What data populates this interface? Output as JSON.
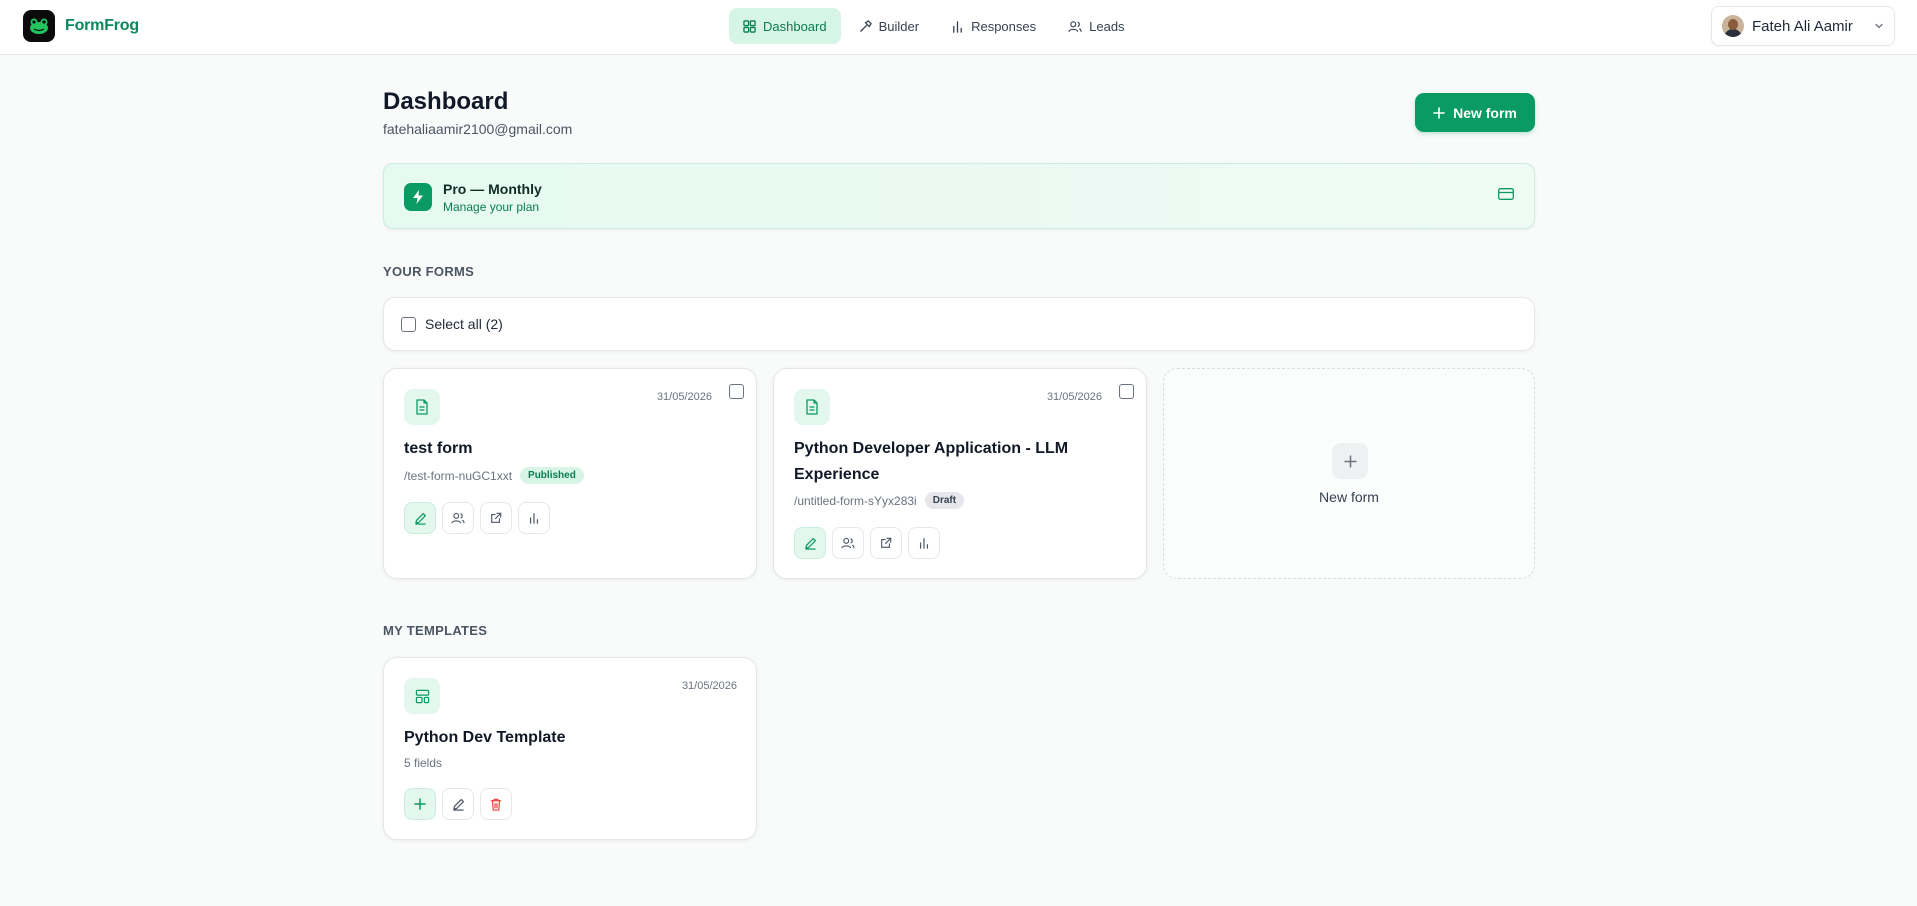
{
  "brand": {
    "name": "FormFrog"
  },
  "nav": {
    "items": [
      {
        "label": "Dashboard",
        "icon": "grid-icon",
        "active": true
      },
      {
        "label": "Builder",
        "icon": "hammer-icon",
        "active": false
      },
      {
        "label": "Responses",
        "icon": "bar-chart-icon",
        "active": false
      },
      {
        "label": "Leads",
        "icon": "users-icon",
        "active": false
      }
    ]
  },
  "user": {
    "name": "Fateh Ali Aamir"
  },
  "header": {
    "title": "Dashboard",
    "email": "fatehaliaamir2100@gmail.com",
    "new_form_label": "New form"
  },
  "plan": {
    "title": "Pro — Monthly",
    "subtitle": "Manage your plan"
  },
  "forms_section": {
    "label": "YOUR FORMS",
    "select_all_label": "Select all (2)",
    "forms": [
      {
        "date": "31/05/2026",
        "title": "test form",
        "slug": "/test-form-nuGC1xxt",
        "status": "Published"
      },
      {
        "date": "31/05/2026",
        "title": "Python Developer Application - LLM Experience",
        "slug": "/untitled-form-sYyx283i",
        "status": "Draft"
      }
    ],
    "new_form_card_label": "New form"
  },
  "templates_section": {
    "label": "MY TEMPLATES",
    "templates": [
      {
        "date": "31/05/2026",
        "title": "Python Dev Template",
        "fields": "5 fields"
      }
    ]
  },
  "colors": {
    "accent": "#0a9a63",
    "accent_light": "#d6f5e6",
    "danger": "#ef4444"
  }
}
